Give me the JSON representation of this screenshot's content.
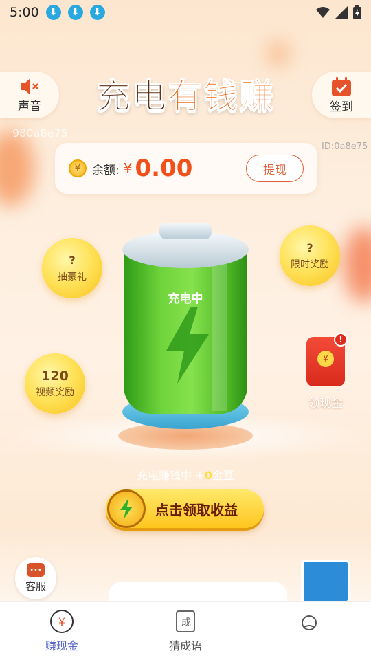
{
  "status_bar": {
    "time": "5:00",
    "download_icons": [
      "download-icon",
      "download-icon",
      "download-icon"
    ],
    "right_icons": [
      "wifi-icon",
      "signal-icon",
      "battery-icon"
    ]
  },
  "header": {
    "sound_label": "声音",
    "checkin_label": "签到",
    "title_part1": "充电",
    "title_part2": "有钱赚",
    "watermark": "980a8e75",
    "device_id": "ID:0a8e75"
  },
  "balance": {
    "label": "余额:",
    "currency": "¥",
    "amount": "0.00",
    "withdraw_label": "提现"
  },
  "bubbles": {
    "lottery": {
      "top": "?",
      "label": "抽豪礼"
    },
    "limited": {
      "top": "?",
      "label": "限时奖励"
    },
    "video": {
      "top": "120",
      "label": "视频奖励"
    }
  },
  "battery": {
    "status": "充电中"
  },
  "red_packet": {
    "badge": "!",
    "label": "领现金"
  },
  "earning": {
    "prefix": "充电赚钱中 +",
    "value": "0",
    "suffix": "金豆"
  },
  "claim_button": {
    "label": "点击领取收益"
  },
  "customer_service": {
    "label": "客服"
  },
  "nav": {
    "items": [
      {
        "label": "赚现金",
        "icon": "yuan-icon",
        "active": true
      },
      {
        "label": "猜成语",
        "icon": "idiom-book-icon",
        "active": false
      },
      {
        "label": "",
        "icon": "profile-icon",
        "active": false
      }
    ]
  },
  "colors": {
    "accent_orange": "#f2501a",
    "gold": "#ffc61e",
    "battery_green": "#6fd43b",
    "nav_active": "#5a68c8"
  }
}
